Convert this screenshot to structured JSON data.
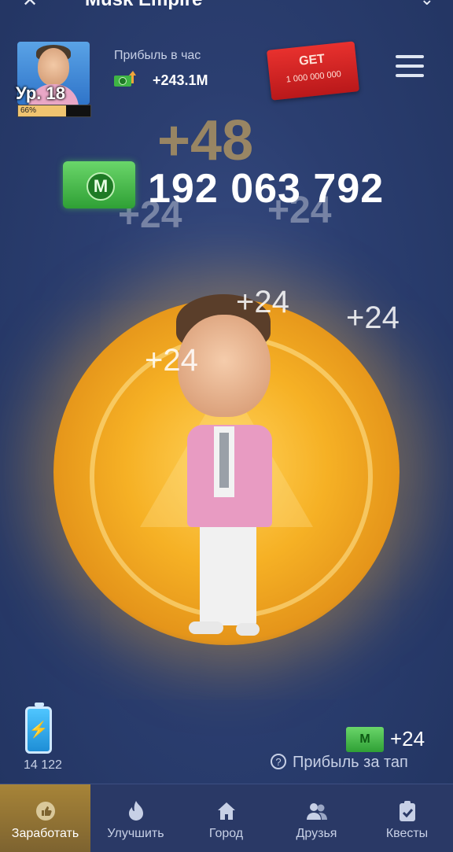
{
  "app": {
    "title": "Musk Empire",
    "back_icon": "back-arrow-icon",
    "menu_icon": "chevron-down-icon"
  },
  "profile": {
    "level_label": "Ур. 18",
    "progress_percent_label": "66%",
    "progress": 0.66
  },
  "profit_per_hour": {
    "label": "Прибыль в час",
    "value": "+243.1M"
  },
  "promo_ticket": {
    "title": "GET",
    "amount": "1 000 000 000"
  },
  "balance": {
    "value": "192 063 792",
    "ghost_big": "+48",
    "ghost_small": "+24"
  },
  "floating_taps": [
    "+24",
    "+24",
    "+24"
  ],
  "energy": {
    "value": "14 122"
  },
  "tap_profit": {
    "value": "+24",
    "label": "Прибыль за тап",
    "money_letter": "M"
  },
  "nav": [
    {
      "label": "Заработать",
      "icon": "thumbs-up-icon",
      "active": true
    },
    {
      "label": "Улучшить",
      "icon": "flame-icon",
      "active": false
    },
    {
      "label": "Город",
      "icon": "home-icon",
      "active": false
    },
    {
      "label": "Друзья",
      "icon": "users-icon",
      "active": false
    },
    {
      "label": "Квесты",
      "icon": "clipboard-check-icon",
      "active": false
    }
  ],
  "colors": {
    "accent_gold": "#f6b125",
    "nav_active": "#a78438",
    "money_green": "#2fa035",
    "ticket_red": "#e8312e"
  }
}
